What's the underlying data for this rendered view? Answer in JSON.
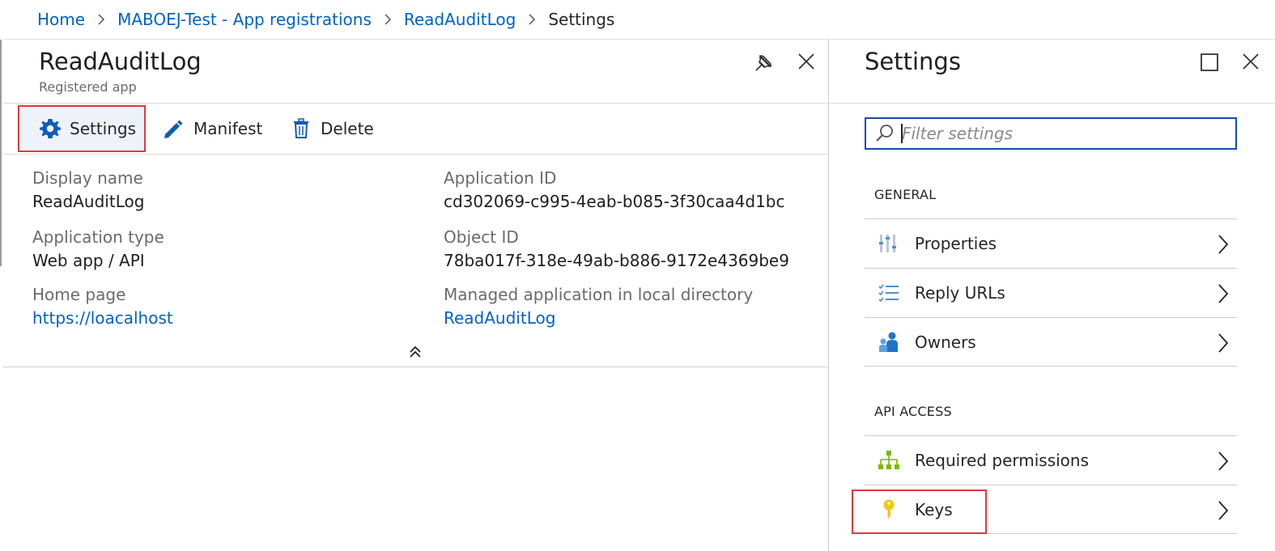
{
  "breadcrumb": {
    "items": [
      "Home",
      "MABOEJ-Test - App registrations",
      "ReadAuditLog",
      "Settings"
    ]
  },
  "left_blade": {
    "title": "ReadAuditLog",
    "subtitle": "Registered app",
    "commands": {
      "settings": "Settings",
      "manifest": "Manifest",
      "delete": "Delete"
    },
    "fields": {
      "display_name_label": "Display name",
      "display_name_value": "ReadAuditLog",
      "application_type_label": "Application type",
      "application_type_value": "Web app / API",
      "home_page_label": "Home page",
      "home_page_value": "https://loacalhost",
      "application_id_label": "Application ID",
      "application_id_value": "cd302069-c995-4eab-b085-3f30caa4d1bc",
      "object_id_label": "Object ID",
      "object_id_value": "78ba017f-318e-49ab-b886-9172e4369be9",
      "managed_app_label": "Managed application in local directory",
      "managed_app_value": "ReadAuditLog"
    }
  },
  "right_blade": {
    "title": "Settings",
    "filter_placeholder": "Filter settings",
    "sections": {
      "general": "GENERAL",
      "api_access": "API ACCESS"
    },
    "general_items": [
      {
        "label": "Properties",
        "icon": "properties-icon"
      },
      {
        "label": "Reply URLs",
        "icon": "reply-urls-icon"
      },
      {
        "label": "Owners",
        "icon": "owners-icon"
      }
    ],
    "api_items": [
      {
        "label": "Required permissions",
        "icon": "permissions-icon"
      },
      {
        "label": "Keys",
        "icon": "key-icon"
      }
    ]
  },
  "colors": {
    "link": "#0062c4",
    "highlight": "#e0393e",
    "accent": "#0f4ea8"
  }
}
